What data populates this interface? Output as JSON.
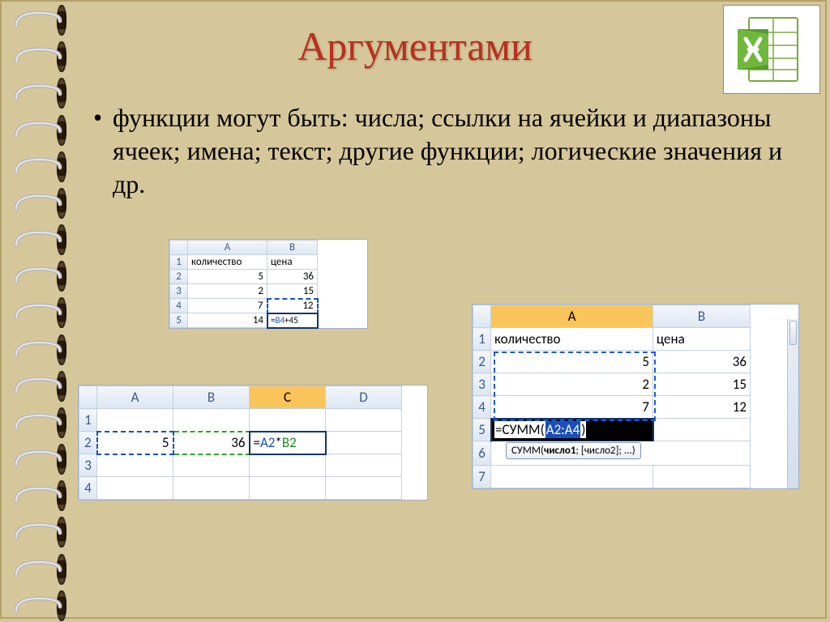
{
  "title": "Аргументами",
  "bullet": "функции могут быть: числа; ссылки на ячейки и диапазоны ячеек; имена; текст; другие функции; логические значения и др.",
  "icon": {
    "name": "excel-icon"
  },
  "sheet1": {
    "col_headers": [
      "A",
      "B"
    ],
    "headers_row": {
      "a": "количество",
      "b": "цена"
    },
    "rows": [
      {
        "a": "5",
        "b": "36"
      },
      {
        "a": "2",
        "b": "15"
      },
      {
        "a": "7",
        "b": "12"
      },
      {
        "a": "14",
        "b_formula_prefix": "=",
        "b_ref": "B4",
        "b_suffix": "+45"
      }
    ]
  },
  "sheet2": {
    "col_headers": [
      "A",
      "B",
      "C",
      "D"
    ],
    "row": {
      "a": "5",
      "b": "36",
      "c_prefix": "=",
      "c_ref1": "A2",
      "c_op": "*",
      "c_ref2": "B2"
    }
  },
  "sheet3": {
    "col_headers": [
      "A",
      "B"
    ],
    "headers_row": {
      "a": "количество",
      "b": "цена"
    },
    "rows": [
      {
        "a": "5",
        "b": "36"
      },
      {
        "a": "2",
        "b": "15"
      },
      {
        "a": "7",
        "b": "12"
      }
    ],
    "formula": {
      "prefix": "=СУММ(",
      "range": "A2:A4",
      "suffix": ")"
    },
    "tooltip_parts": {
      "fn": "СУММ(",
      "arg1": "число1",
      "sep": "; [число2]; ...)"
    }
  }
}
